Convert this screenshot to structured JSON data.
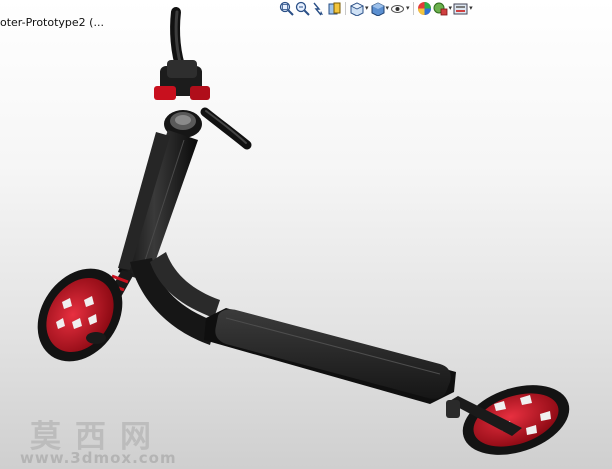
{
  "window": {
    "document_title": "oter-Prototype2  (..."
  },
  "toolbar": {
    "buttons": [
      {
        "name": "zoom-to-fit-icon",
        "has_menu": false
      },
      {
        "name": "zoom-to-area-icon",
        "has_menu": false
      },
      {
        "name": "previous-view-icon",
        "has_menu": false
      },
      {
        "name": "section-view-icon",
        "has_menu": false
      },
      {
        "name": "view-orientation-icon",
        "has_menu": true
      },
      {
        "name": "display-style-icon",
        "has_menu": true
      },
      {
        "name": "hide-show-items-icon",
        "has_menu": true
      },
      {
        "name": "edit-appearance-icon",
        "has_menu": false
      },
      {
        "name": "apply-scene-icon",
        "has_menu": true
      },
      {
        "name": "view-settings-icon",
        "has_menu": true
      }
    ],
    "menu_arrow_glyph": "▾"
  },
  "model": {
    "frame_color": "#1e1e1e",
    "accent_color": "#c8101e",
    "deck_color": "#242424"
  },
  "watermark": {
    "chinese": "莫西网",
    "url": "www.3dmox.com"
  }
}
